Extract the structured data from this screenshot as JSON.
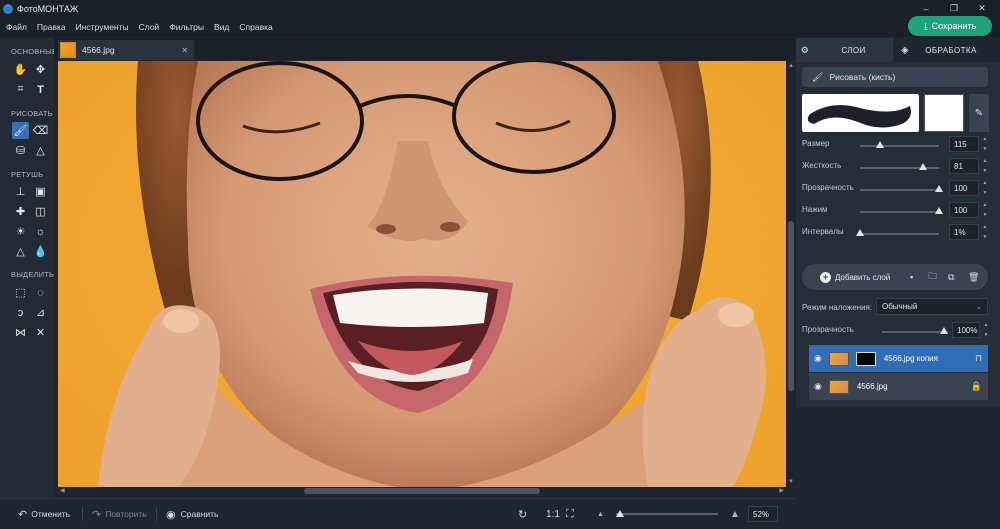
{
  "window": {
    "title": "ФотоМОНТАЖ",
    "controls": [
      "–",
      "❐",
      "✕"
    ]
  },
  "menu": {
    "items": [
      "Файл",
      "Правка",
      "Инструменты",
      "Слой",
      "Фильтры",
      "Вид",
      "Справка"
    ]
  },
  "save_button": {
    "label": "Сохранить"
  },
  "tools": {
    "sections": {
      "basic": "ОСНОВНЫЕ",
      "draw": "РИСОВАТЬ",
      "retouch": "РЕТУШЬ",
      "select": "ВЫДЕЛИТЬ"
    }
  },
  "document_tab": {
    "name": "4566.jpg",
    "close": "✕"
  },
  "bottom": {
    "undo": "Отменить",
    "redo": "Повторить",
    "compare": "Сравнить",
    "ratio": "1:1",
    "zoom_value": "52%",
    "zoom_level": 0.52
  },
  "right_panel": {
    "tabs": [
      "СЛОИ",
      "ОБРАБОТКА"
    ],
    "tool_name": "Рисовать (кисть)",
    "brush": [
      {
        "label": "Размер",
        "value": "115",
        "level": 0.25
      },
      {
        "label": "Жесткость",
        "value": "81",
        "level": 0.8
      },
      {
        "label": "Прозрачность",
        "value": "100",
        "level": 1.0
      },
      {
        "label": "Нажим",
        "value": "100",
        "level": 1.0
      },
      {
        "label": "Интервалы",
        "value": "1%",
        "level": 0.0
      }
    ],
    "add_layer": "Добавить слой",
    "blend_label": "Режим наложения:",
    "blend_value": "Обычный",
    "opacity_label": "Прозрачность",
    "opacity_value": "100%",
    "layers": [
      {
        "name": "4566.jpg копия",
        "selected": true
      },
      {
        "name": "4566.jpg",
        "selected": false
      }
    ]
  },
  "colors": {
    "accent": "#1fa37a",
    "selected": "#2f6db5",
    "panel": "#252d39"
  }
}
